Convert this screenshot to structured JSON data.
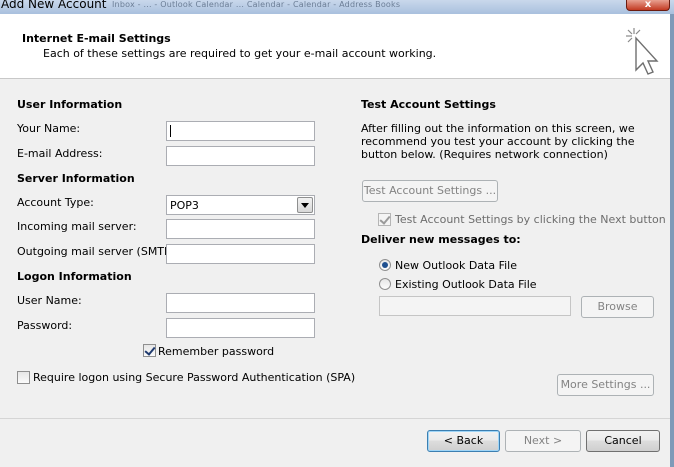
{
  "window": {
    "title": "Add New Account",
    "background_title": "Inbox - ... - Outlook Calendar ... Calendar - Calendar - Address Books",
    "close_label": "x"
  },
  "header": {
    "title": "Internet E-mail Settings",
    "subtitle": "Each of these settings are required to get your e-mail account working.",
    "icon": "cursor-sparkle-icon"
  },
  "user_info": {
    "heading": "User Information",
    "name_label": "Your Name:",
    "name_value": "",
    "email_label": "E-mail Address:",
    "email_value": ""
  },
  "server_info": {
    "heading": "Server Information",
    "account_type_label": "Account Type:",
    "account_type_value": "POP3",
    "incoming_label": "Incoming mail server:",
    "incoming_value": "",
    "outgoing_label": "Outgoing mail server (SMTP):",
    "outgoing_value": ""
  },
  "logon_info": {
    "heading": "Logon Information",
    "username_label": "User Name:",
    "username_value": "",
    "password_label": "Password:",
    "password_value": "",
    "remember_label": "Remember password",
    "remember_checked": true,
    "spa_label": "Require logon using Secure Password Authentication (SPA)",
    "spa_checked": false
  },
  "test_settings": {
    "heading": "Test Account Settings",
    "description": "After filling out the information on this screen, we recommend you test your account by clicking the button below. (Requires network connection)",
    "test_button": "Test Account Settings ...",
    "test_next_label": "Test Account Settings by clicking the Next button",
    "test_next_checked": true
  },
  "delivery": {
    "heading": "Deliver new messages to:",
    "new_file_label": "New Outlook Data File",
    "existing_file_label": "Existing Outlook Data File",
    "selected": "New Outlook Data File",
    "browse_button": "Browse"
  },
  "buttons": {
    "more_settings": "More Settings ...",
    "back": "< Back",
    "next": "Next >",
    "cancel": "Cancel"
  }
}
